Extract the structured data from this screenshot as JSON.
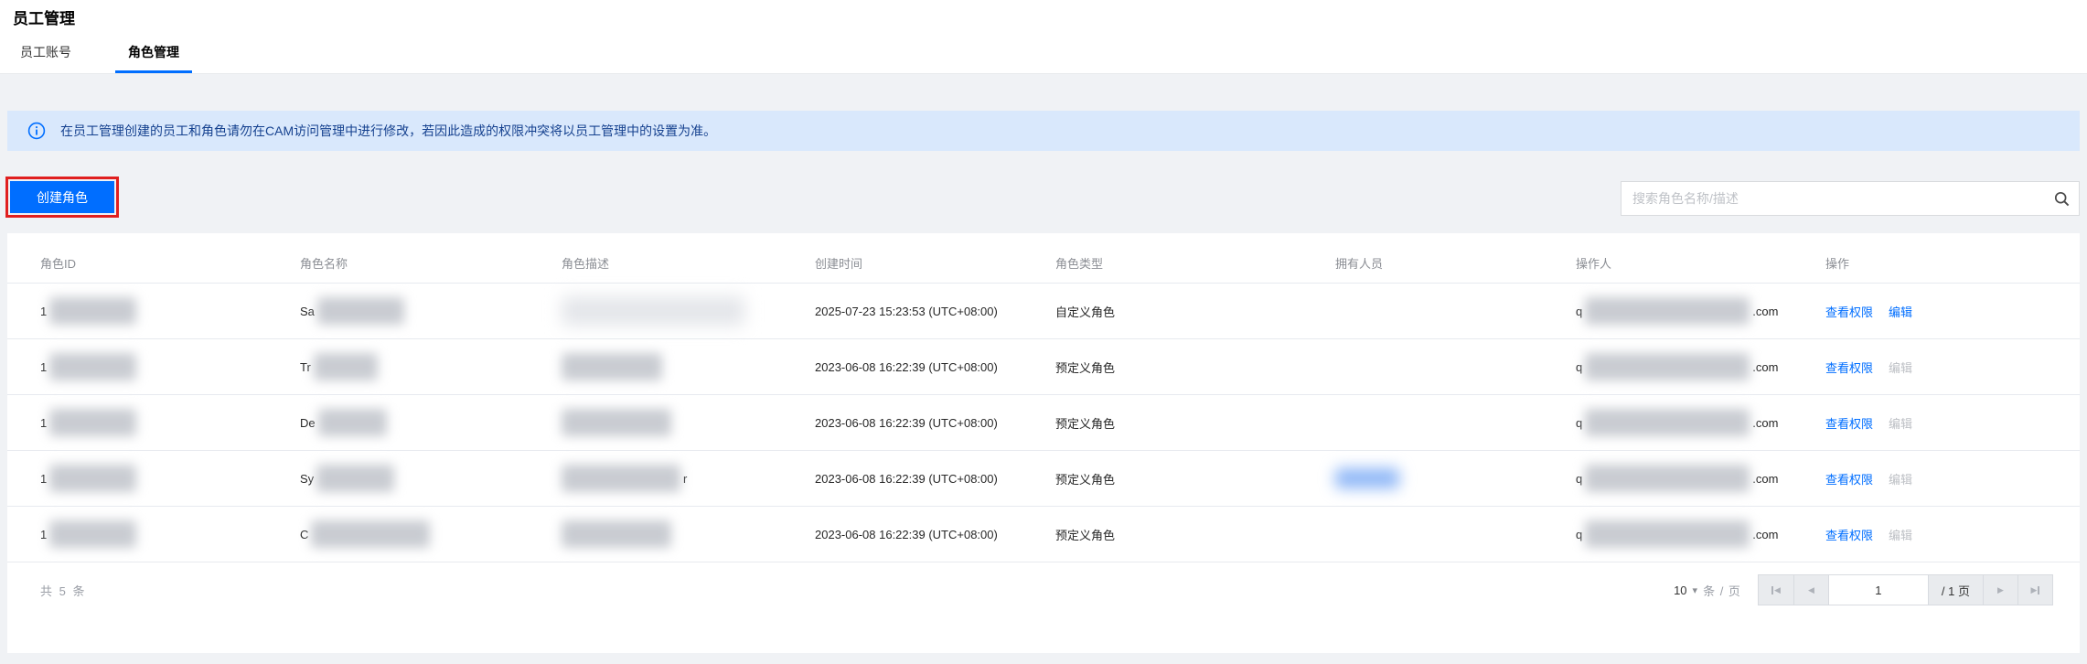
{
  "page": {
    "title": "员工管理"
  },
  "tabs": [
    {
      "label": "员工账号",
      "active": false
    },
    {
      "label": "角色管理",
      "active": true
    }
  ],
  "banner": {
    "text": "在员工管理创建的员工和角色请勿在CAM访问管理中进行修改，若因此造成的权限冲突将以员工管理中的设置为准。"
  },
  "toolbar": {
    "create_button": "创建角色",
    "search_placeholder": "搜索角色名称/描述"
  },
  "table": {
    "columns": [
      "角色ID",
      "角色名称",
      "角色描述",
      "创建时间",
      "角色类型",
      "拥有人员",
      "操作人",
      "操作"
    ],
    "action_labels": {
      "view": "查看权限",
      "edit": "编辑"
    },
    "rows": [
      {
        "id_prefix": "1",
        "name_prefix": "Sa",
        "desc_suffix": "",
        "created": "2025-07-23 15:23:53 (UTC+08:00)",
        "type": "自定义角色",
        "owner_blur": false,
        "operator_prefix": "q",
        "operator_suffix": ".com",
        "edit_enabled": true,
        "blur": {
          "id_w": 95,
          "name_w": 95,
          "desc_w": 200,
          "desc_light": true,
          "op_w": 180
        }
      },
      {
        "id_prefix": "1",
        "name_prefix": "Tr",
        "desc_suffix": "",
        "created": "2023-06-08 16:22:39 (UTC+08:00)",
        "type": "预定义角色",
        "owner_blur": false,
        "operator_prefix": "q",
        "operator_suffix": ".com",
        "edit_enabled": false,
        "blur": {
          "id_w": 95,
          "name_w": 70,
          "desc_w": 110,
          "desc_light": false,
          "op_w": 180
        }
      },
      {
        "id_prefix": "1",
        "name_prefix": "De",
        "desc_suffix": "",
        "created": "2023-06-08 16:22:39 (UTC+08:00)",
        "type": "预定义角色",
        "owner_blur": false,
        "operator_prefix": "q",
        "operator_suffix": ".com",
        "edit_enabled": false,
        "blur": {
          "id_w": 95,
          "name_w": 75,
          "desc_w": 120,
          "desc_light": false,
          "op_w": 180
        }
      },
      {
        "id_prefix": "1",
        "name_prefix": "Sy",
        "desc_suffix": "r",
        "created": "2023-06-08 16:22:39 (UTC+08:00)",
        "type": "预定义角色",
        "owner_blur": true,
        "operator_prefix": "q",
        "operator_suffix": ".com",
        "edit_enabled": false,
        "blur": {
          "id_w": 95,
          "name_w": 85,
          "desc_w": 130,
          "desc_light": false,
          "op_w": 180
        }
      },
      {
        "id_prefix": "1",
        "name_prefix": "C",
        "desc_suffix": "",
        "created": "2023-06-08 16:22:39 (UTC+08:00)",
        "type": "预定义角色",
        "owner_blur": false,
        "operator_prefix": "q",
        "operator_suffix": ".com",
        "edit_enabled": false,
        "blur": {
          "id_w": 95,
          "name_w": 130,
          "desc_w": 120,
          "desc_light": false,
          "op_w": 180
        }
      }
    ]
  },
  "footer": {
    "total": "共 5 条",
    "page_size": "10",
    "per_page_label": "条 / 页",
    "page_current": "1",
    "page_total_label": "/ 1 页"
  },
  "icons": {
    "dropdown_arrow": "▾",
    "page_prev": "◀",
    "page_next": "▶"
  },
  "colors": {
    "accent_blue": "#006eff",
    "banner_bg": "#d9e8fc",
    "banner_text": "#15418f",
    "annotation_red": "#e01f1f",
    "page_bg": "#f0f2f5",
    "disabled_text": "#bcbfc4"
  }
}
